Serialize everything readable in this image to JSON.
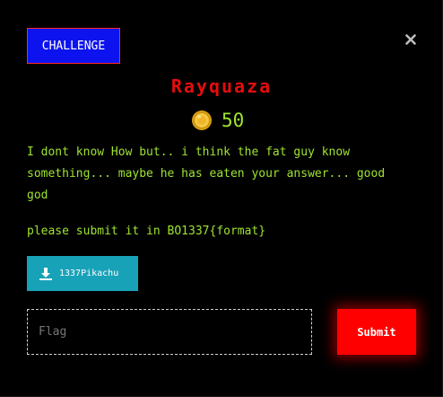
{
  "modal": {
    "tab_label": "CHALLENGE",
    "close_icon": "close-icon",
    "title": "Rayquaza",
    "points": "50",
    "coin_icon": "coin-icon",
    "description": "I dont know How but.. i think the fat guy know something... maybe he has eaten your answer... good god",
    "submit_note": "please submit it in BO1337{format}",
    "download": {
      "icon": "download-icon",
      "label": "1337Pikachu"
    },
    "flag_input": {
      "value": "",
      "placeholder": "Flag"
    },
    "submit_label": "Submit"
  },
  "colors": {
    "background": "#000000",
    "tab_bg": "#0d13ee",
    "tab_border": "#ff2a2a",
    "title": "#e40d0d",
    "text_green": "#9fe330",
    "download_bg": "#17a2b8",
    "submit_bg": "#ff0000"
  }
}
